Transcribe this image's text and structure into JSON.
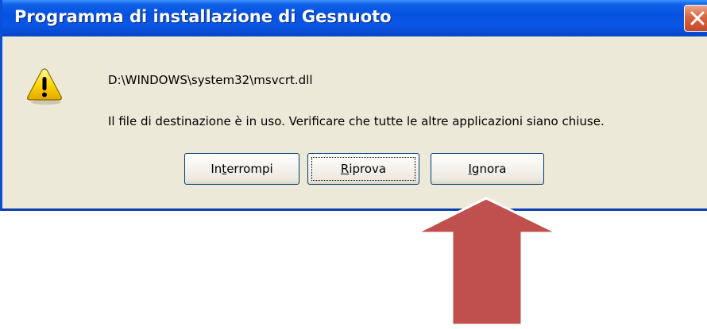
{
  "window": {
    "title": "Programma di installazione di Gesnuoto",
    "close_icon": "close-icon"
  },
  "message": {
    "icon": "warning-icon",
    "path": "D:\\WINDOWS\\system32\\msvcrt.dll",
    "text": "Il file di destinazione è in uso. Verificare che tutte le altre applicazioni siano chiuse."
  },
  "buttons": {
    "interrompi": {
      "pre": "In",
      "mnemonic": "t",
      "post": "errompi"
    },
    "riprova": {
      "pre": "",
      "mnemonic": "R",
      "post": "iprova"
    },
    "ignora": {
      "pre": "",
      "mnemonic": "I",
      "post": "gnora"
    }
  },
  "annotation": {
    "arrow_icon": "arrow-up-icon",
    "arrow_color": "#c0504d"
  },
  "colors": {
    "titlebar": "#0552e0",
    "dialog_bg": "#ece9d8",
    "close_button": "#d9663f"
  }
}
